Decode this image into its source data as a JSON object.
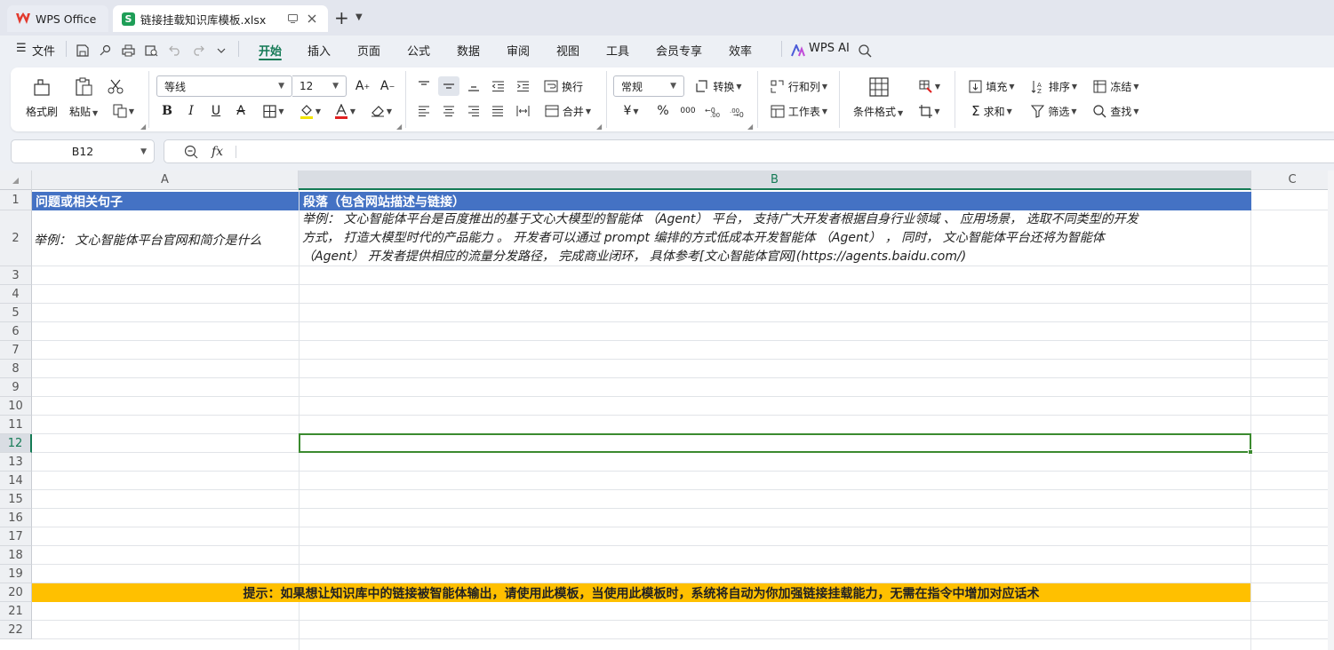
{
  "tabs": {
    "home_label": "WPS Office",
    "file_label": "链接挂载知识库模板.xlsx",
    "file_icon_letter": "S"
  },
  "menu": {
    "file_label": "文件",
    "items": [
      "开始",
      "插入",
      "页面",
      "公式",
      "数据",
      "审阅",
      "视图",
      "工具",
      "会员专享",
      "效率"
    ],
    "active": "开始",
    "ai_label": "WPS AI"
  },
  "ribbon": {
    "format_painter": "格式刷",
    "paste": "粘贴",
    "font_name": "等线",
    "font_size": "12",
    "wrap": "换行",
    "merge": "合并",
    "number_format": "常规",
    "convert": "转换",
    "row_col": "行和列",
    "worksheet": "工作表",
    "cond_format": "条件格式",
    "fill": "填充",
    "sort": "排序",
    "freeze": "冻结",
    "sum": "求和",
    "filter": "筛选",
    "find": "查找",
    "currency_symbol": "¥",
    "percent_symbol": "%",
    "thousands_symbol": "000"
  },
  "formula_bar": {
    "cell_ref": "B12",
    "fx_label": "fx",
    "content": ""
  },
  "sheet": {
    "columns": [
      "A",
      "B",
      "C"
    ],
    "selected_column": "B",
    "rows": [
      "1",
      "2",
      "3",
      "4",
      "5",
      "6",
      "7",
      "8",
      "9",
      "10",
      "11",
      "12",
      "13",
      "14",
      "15",
      "16",
      "17",
      "18",
      "19",
      "20",
      "21",
      "22"
    ],
    "selected_row": "12",
    "header_a": "问题或相关句子",
    "header_b": "段落（包含网站描述与链接）",
    "example_a": "举例： 文心智能体平台官网和简介是什么",
    "example_b_line1": "举例： 文心智能体平台是百度推出的基于文心大模型的智能体 （Agent） 平台， 支持广大开发者根据自身行业领域 、 应用场景， 选取不同类型的开发",
    "example_b_line2": "方式， 打造大模型时代的产品能力 。 开发者可以通过 prompt 编排的方式低成本开发智能体 （Agent） ， 同时， 文心智能体平台还将为智能体",
    "example_b_line3": "（Agent） 开发者提供相应的流量分发路径， 完成商业闭环， 具体参考[文心智能体官网](https://agents.baidu.com/)",
    "tip": "提示：如果想让知识库中的链接被智能体输出，请使用此模板，当使用此模板时，系统将自动为你加强链接挂载能力，无需在指令中增加对应话术"
  },
  "colors": {
    "accent": "#147a55",
    "header_fill": "#4472c4",
    "tip_fill": "#ffc000",
    "selection": "#3b8a2f"
  }
}
